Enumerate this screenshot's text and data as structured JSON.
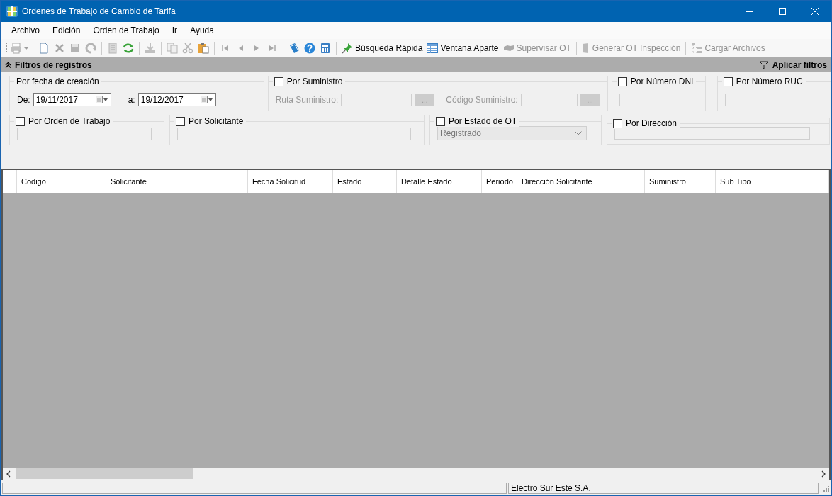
{
  "window": {
    "title": "Ordenes de Trabajo de Cambio de Tarifa"
  },
  "menu": [
    "Archivo",
    "Edición",
    "Orden de Trabajo",
    "Ir",
    "Ayuda"
  ],
  "toolbar": {
    "icon_buttons": [
      {
        "disabled": true
      },
      {
        "disabled": false
      },
      {
        "disabled": true
      },
      {
        "disabled": true
      },
      {
        "disabled": true
      },
      {
        "disabled": true
      },
      {
        "disabled": false
      },
      {
        "disabled": true
      },
      {
        "disabled": true
      },
      {
        "disabled": true
      },
      {
        "disabled": false
      },
      {
        "disabled": true
      },
      {
        "disabled": true
      },
      {
        "disabled": true
      },
      {
        "disabled": true
      },
      {
        "disabled": false
      },
      {
        "disabled": false
      },
      {
        "disabled": false
      }
    ],
    "labeled_buttons": [
      {
        "label": "Búsqueda Rápida",
        "disabled": false
      },
      {
        "label": "Ventana Aparte",
        "disabled": false
      },
      {
        "label": "Supervisar OT",
        "disabled": true
      },
      {
        "label": "Generar OT Inspección",
        "disabled": true
      },
      {
        "label": "Cargar Archivos",
        "disabled": true
      }
    ]
  },
  "filters": {
    "title": "Filtros de registros",
    "expanded": true,
    "apply_label": "Aplicar filtros",
    "date_group": {
      "label": "Por fecha de creación",
      "from_label": "De:",
      "from_value": "19/11/2017",
      "to_label": "a:",
      "to_value": "19/12/2017"
    },
    "supply_group": {
      "label": "Por Suministro",
      "checked": false,
      "route_label": "Ruta Suministro:",
      "code_label": "Código Suministro:",
      "browse_label": "..."
    },
    "dni_group": {
      "label": "Por Número DNI",
      "checked": false
    },
    "ruc_group": {
      "label": "Por Número RUC",
      "checked": false
    },
    "order_group": {
      "label": "Por Orden de Trabajo",
      "checked": false
    },
    "requester_group": {
      "label": "Por Solicitante",
      "checked": false
    },
    "status_group": {
      "label": "Por Estado de OT",
      "checked": false,
      "value": "Registrado"
    },
    "address_group": {
      "label": "Por Dirección",
      "checked": false
    }
  },
  "table": {
    "columns": [
      "Codigo",
      "Solicitante",
      "Fecha Solicitud",
      "Estado",
      "Detalle Estado",
      "Periodo",
      "Dirección Solicitante",
      "Suministro",
      "Sub Tipo"
    ]
  },
  "status_bar": {
    "panels": [
      "Electro Sur Este S.A."
    ]
  }
}
